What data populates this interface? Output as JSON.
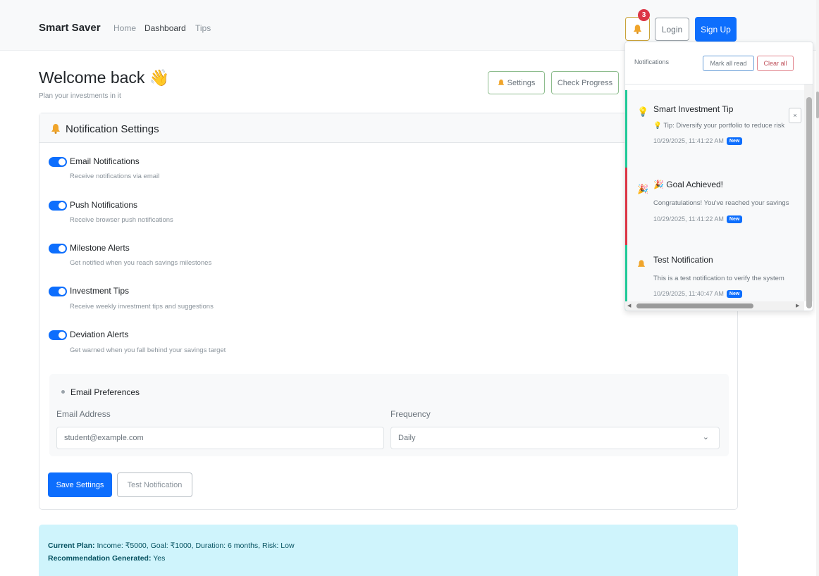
{
  "navbar": {
    "brand": "Smart Saver",
    "links": [
      "Home",
      "Dashboard",
      "Tips"
    ],
    "notification_count": "3",
    "login_label": "Login",
    "signup_label": "Sign Up"
  },
  "header": {
    "welcome": "Welcome back",
    "subtitle": "Plan your investments in it",
    "settings_label": "Settings",
    "check_progress_label": "Check Progress"
  },
  "settings_card": {
    "title": "Notification Settings",
    "items": [
      {
        "title": "Email Notifications",
        "desc": "Receive notifications via email",
        "enabled": true
      },
      {
        "title": "Push Notifications",
        "desc": "Receive browser push notifications",
        "enabled": true
      },
      {
        "title": "Milestone Alerts",
        "desc": "Get notified when you reach savings milestones",
        "enabled": true
      },
      {
        "title": "Investment Tips",
        "desc": "Receive weekly investment tips and suggestions",
        "enabled": true
      },
      {
        "title": "Deviation Alerts",
        "desc": "Get warned when you fall behind your savings target",
        "enabled": true
      }
    ],
    "email_prefs": {
      "title": "Email Preferences",
      "email_label": "Email Address",
      "email_value": "student@example.com",
      "frequency_label": "Frequency",
      "frequency_value": "Daily"
    },
    "save_label": "Save Settings",
    "test_label": "Test Notification"
  },
  "info": {
    "plan_label": "Current Plan:",
    "plan_text": "Income: ₹5000, Goal: ₹1000, Duration: 6 months, Risk: Low",
    "rec_label": "Recommendation Generated:",
    "rec_text": "Yes"
  },
  "notifications_panel": {
    "title": "Notifications",
    "mark_all_label": "Mark all read",
    "clear_all_label": "Clear all",
    "close_glyph": "×",
    "items": [
      {
        "title": "Smart Investment Tip",
        "body": "Tip: Diversify your portfolio to reduce risk",
        "time": "10/29/2025, 11:41:22 AM",
        "badge": "New",
        "accent": "#20c997"
      },
      {
        "title": "Goal Achieved!",
        "body": "Congratulations! You've reached your savings",
        "time": "10/29/2025, 11:41:22 AM",
        "badge": "New",
        "accent": "#dc3545"
      },
      {
        "title": "Test Notification",
        "body": "This is a test notification to verify the system",
        "time": "10/29/2025, 11:40:47 AM",
        "badge": "New",
        "accent": "#20c997"
      }
    ]
  },
  "colors": {
    "primary": "#0d6efd",
    "danger": "#dc3545",
    "info_bg": "#cff4fc",
    "bell": "#f0a52b"
  },
  "icons": [
    "bell-icon",
    "wave-icon",
    "lightbulb-icon",
    "party-icon",
    "chevron-down-icon",
    "close-icon"
  ]
}
